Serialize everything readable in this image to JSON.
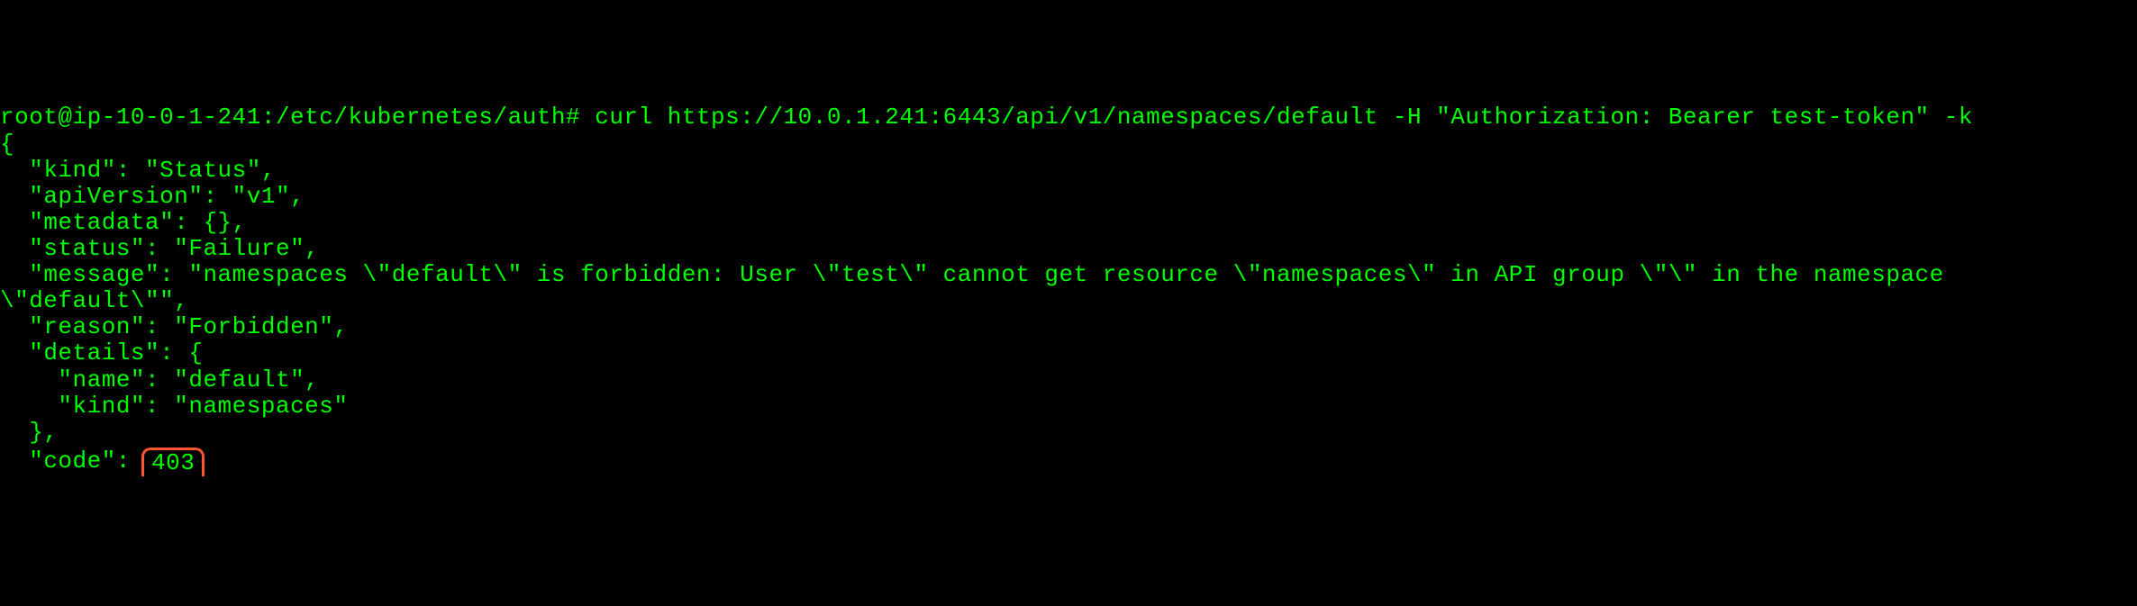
{
  "terminal": {
    "prompt": "root@ip-10-0-1-241:/etc/kubernetes/auth#",
    "command": "curl https://10.0.1.241:6443/api/v1/namespaces/default -H \"Authorization: Bearer test-token\" -k",
    "response": {
      "open_brace": "{",
      "kind_line": "  \"kind\": \"Status\",",
      "apiversion_line": "  \"apiVersion\": \"v1\",",
      "metadata_line": "  \"metadata\": {},",
      "status_line": "  \"status\": \"Failure\",",
      "message_line": "  \"message\": \"namespaces \\\"default\\\" is forbidden: User \\\"test\\\" cannot get resource \\\"namespaces\\\" in API group \\\"\\\" in the namespace \\\"default\\\"\",",
      "reason_line": "  \"reason\": \"Forbidden\",",
      "details_open": "  \"details\": {",
      "details_name": "    \"name\": \"default\",",
      "details_kind": "    \"kind\": \"namespaces\"",
      "details_close": "  },",
      "code_label": "  \"code\": ",
      "code_value": "403"
    }
  }
}
